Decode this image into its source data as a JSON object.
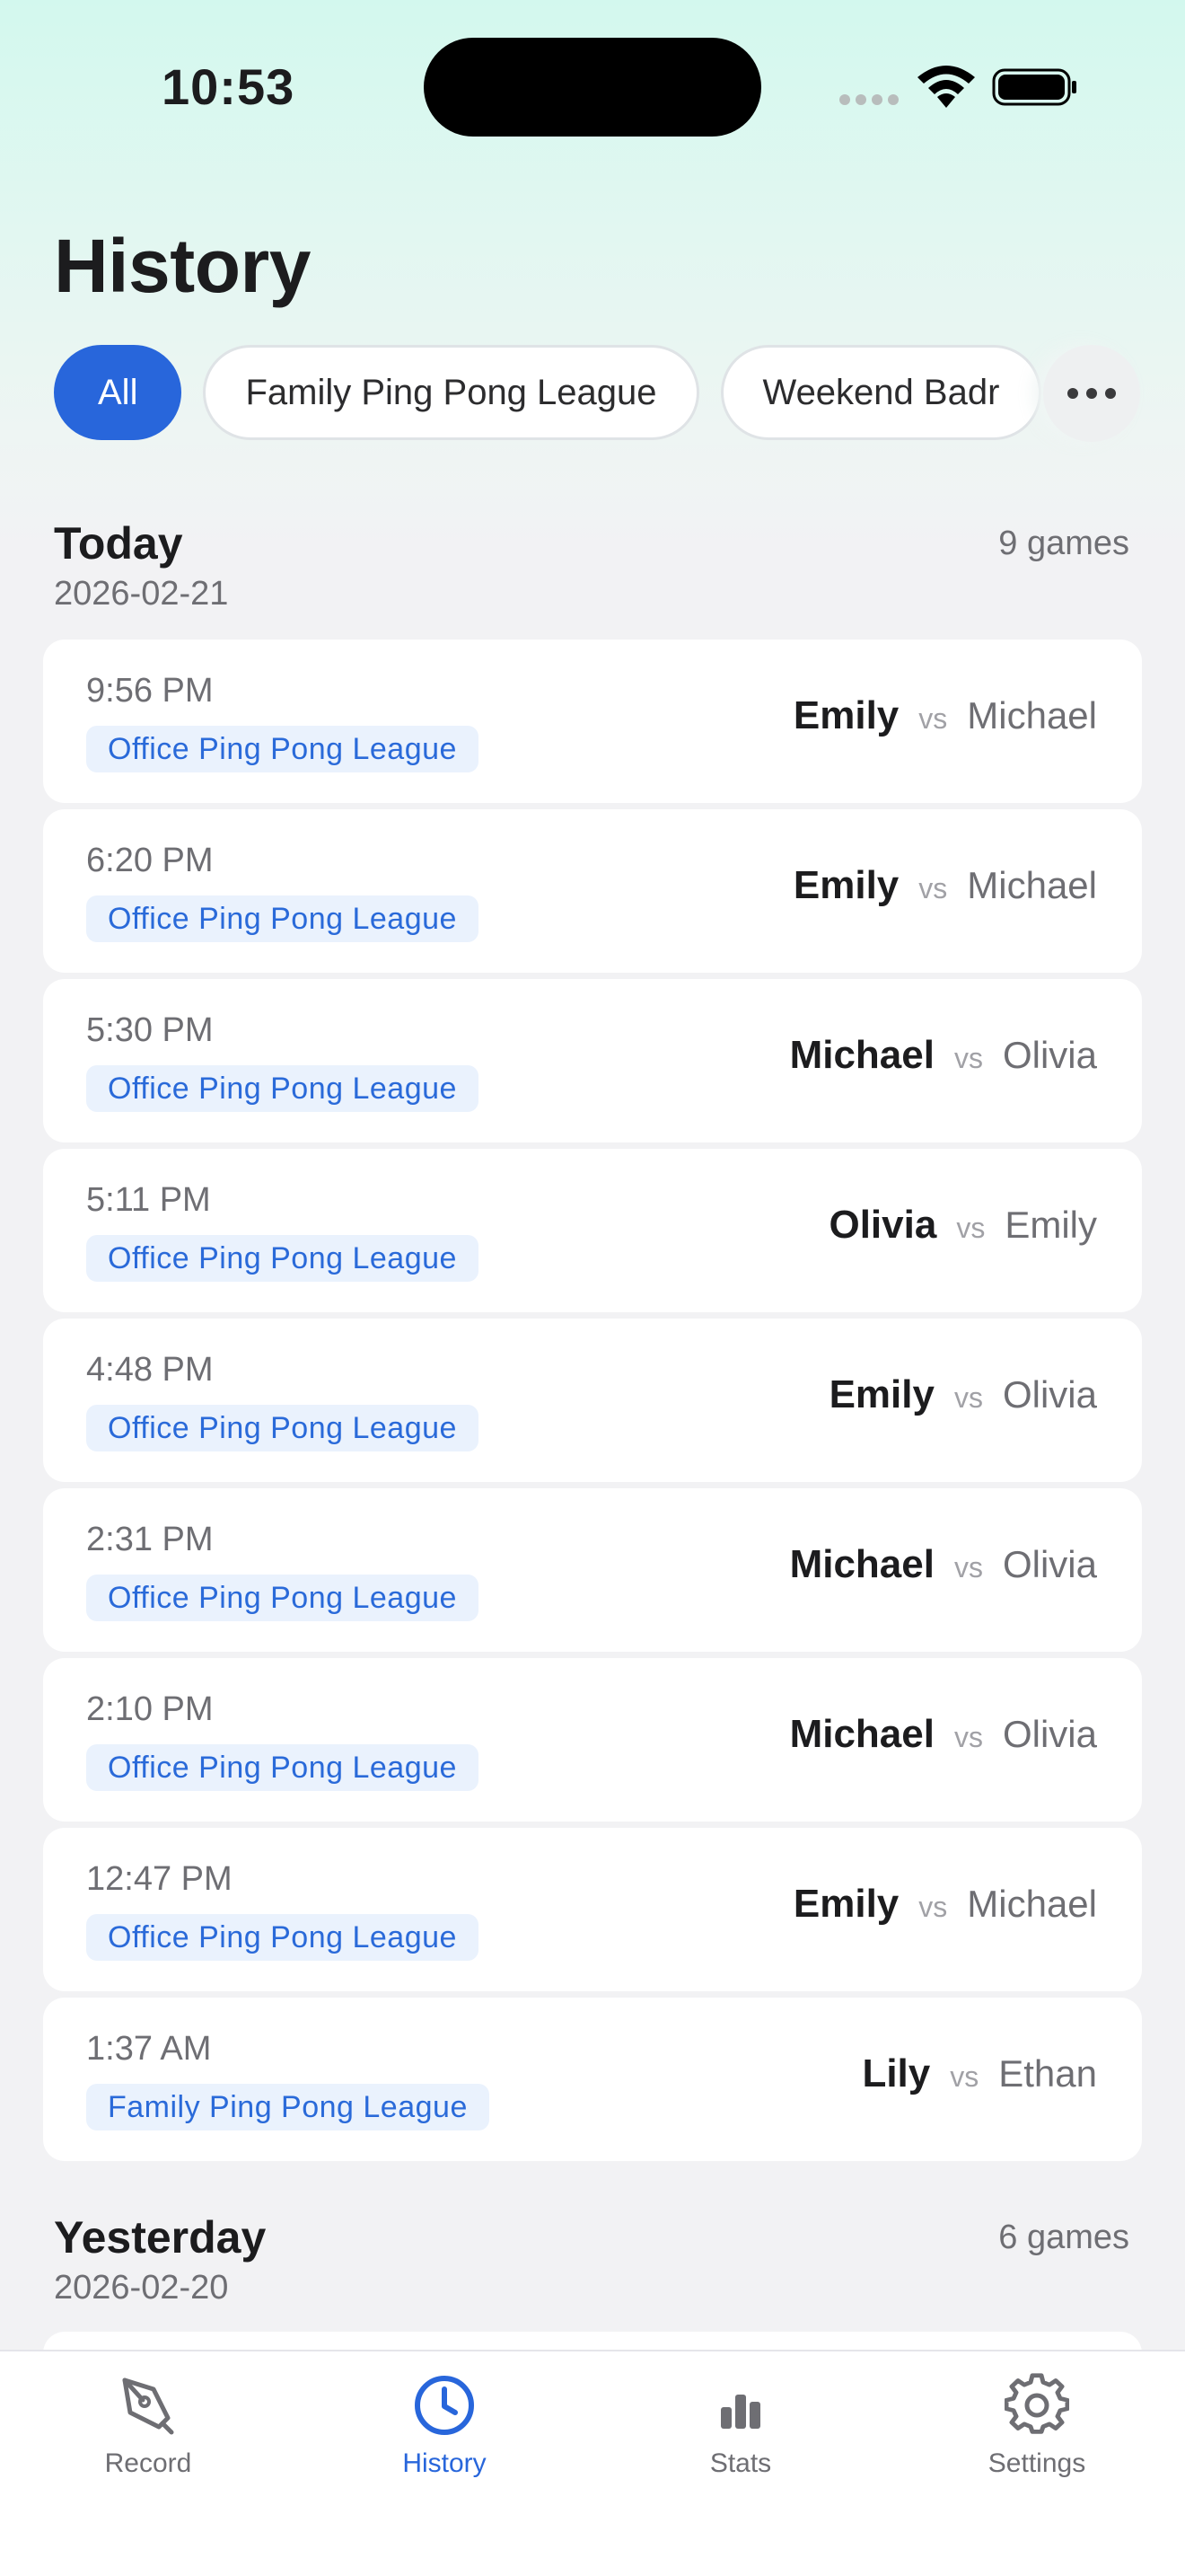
{
  "status_bar": {
    "time": "10:53"
  },
  "page": {
    "title": "History"
  },
  "filters": {
    "chips": [
      {
        "label": "All",
        "active": true
      },
      {
        "label": "Family Ping Pong League",
        "active": false
      },
      {
        "label": "Weekend Badr",
        "active": false
      }
    ],
    "more_icon": "ellipsis-icon"
  },
  "sections": [
    {
      "title": "Today",
      "date": "2026-02-21",
      "count": "9 games",
      "games": [
        {
          "time": "9:56 PM",
          "league": "Office Ping Pong League",
          "winner": "Emily",
          "vs": "vs",
          "loser": "Michael"
        },
        {
          "time": "6:20 PM",
          "league": "Office Ping Pong League",
          "winner": "Emily",
          "vs": "vs",
          "loser": "Michael"
        },
        {
          "time": "5:30 PM",
          "league": "Office Ping Pong League",
          "winner": "Michael",
          "vs": "vs",
          "loser": "Olivia"
        },
        {
          "time": "5:11 PM",
          "league": "Office Ping Pong League",
          "winner": "Olivia",
          "vs": "vs",
          "loser": "Emily"
        },
        {
          "time": "4:48 PM",
          "league": "Office Ping Pong League",
          "winner": "Emily",
          "vs": "vs",
          "loser": "Olivia"
        },
        {
          "time": "2:31 PM",
          "league": "Office Ping Pong League",
          "winner": "Michael",
          "vs": "vs",
          "loser": "Olivia"
        },
        {
          "time": "2:10 PM",
          "league": "Office Ping Pong League",
          "winner": "Michael",
          "vs": "vs",
          "loser": "Olivia"
        },
        {
          "time": "12:47 PM",
          "league": "Office Ping Pong League",
          "winner": "Emily",
          "vs": "vs",
          "loser": "Michael"
        },
        {
          "time": "1:37 AM",
          "league": "Family Ping Pong League",
          "winner": "Lily",
          "vs": "vs",
          "loser": "Ethan"
        }
      ]
    },
    {
      "title": "Yesterday",
      "date": "2026-02-20",
      "count": "6 games"
    }
  ],
  "tab_bar": {
    "tabs": [
      {
        "label": "Record",
        "icon": "pen-icon",
        "active": false
      },
      {
        "label": "History",
        "icon": "clock-icon",
        "active": true
      },
      {
        "label": "Stats",
        "icon": "bar-chart-icon",
        "active": false
      },
      {
        "label": "Settings",
        "icon": "gear-icon",
        "active": false
      }
    ]
  },
  "colors": {
    "accent": "#2866db",
    "league_tag_bg": "#eaf2fd",
    "league_tag_text": "#2a6ad9",
    "background": "#f2f2f4",
    "header_tint": "#d3f8ee"
  }
}
